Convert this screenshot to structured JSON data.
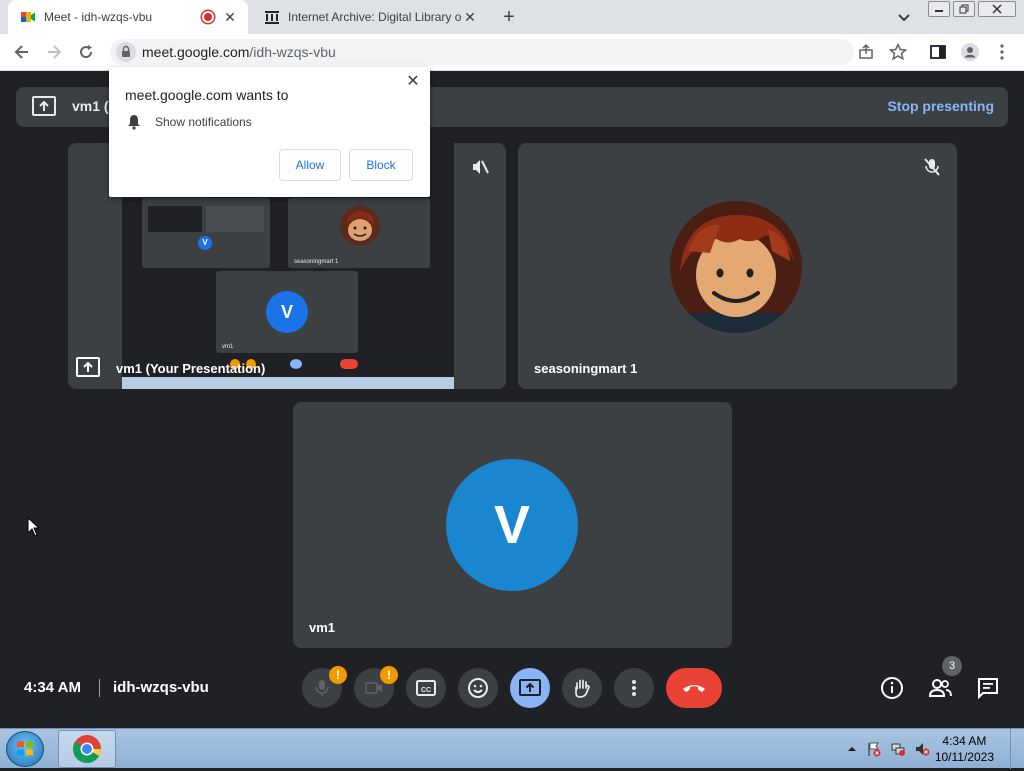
{
  "browser": {
    "tabs": [
      {
        "title": "Meet - idh-wzqs-vbu",
        "active": true,
        "recording": true
      },
      {
        "title": "Internet Archive: Digital Library o",
        "active": false
      }
    ],
    "url_host": "meet.google.com",
    "url_path": "/idh-wzqs-vbu"
  },
  "meet": {
    "presenting_label": "vm1 (",
    "stop_presenting": "Stop presenting",
    "tiles": [
      {
        "name": "vm1 (Your Presentation)"
      },
      {
        "name": "seasoningmart 1"
      },
      {
        "name": "vm1",
        "initial": "V"
      }
    ],
    "mini": {
      "v": "V",
      "label1": "vm1",
      "label2": "seasoningmart 1"
    },
    "time": "4:34 AM",
    "meeting_code": "idh-wzqs-vbu",
    "participants_count": "3",
    "colors": {
      "accent": "#8ab4f8",
      "end_call": "#ea4335",
      "warning": "#f29900",
      "avatar": "#1a73e8"
    }
  },
  "permission_popup": {
    "heading": "meet.google.com wants to",
    "permission": "Show notifications",
    "allow": "Allow",
    "block": "Block"
  },
  "taskbar": {
    "time": "4:34 AM",
    "date": "10/11/2023"
  }
}
